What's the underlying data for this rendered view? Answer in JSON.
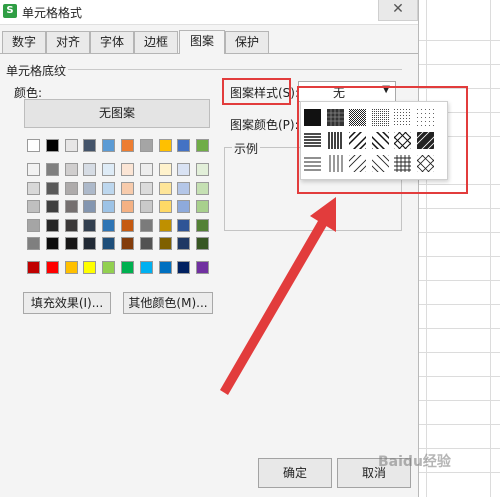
{
  "window": {
    "title": "单元格格式",
    "app_icon_glyph": "S",
    "close_glyph": "✕"
  },
  "tabs": [
    {
      "label": "数字"
    },
    {
      "label": "对齐"
    },
    {
      "label": "字体"
    },
    {
      "label": "边框"
    },
    {
      "label": "图案",
      "active": true
    },
    {
      "label": "保护"
    }
  ],
  "shading": {
    "section_title": "单元格底纹",
    "color_label": "颜色:",
    "no_pattern_button": "无图案",
    "fill_effects_button": "填充效果(I)...",
    "more_colors_button": "其他颜色(M)..."
  },
  "palette": {
    "top_row": [
      "#ffffff",
      "#000000",
      "#e7e6e6",
      "#44546a",
      "#5b9bd5",
      "#ed7d31",
      "#a5a5a5",
      "#ffc000",
      "#4472c4",
      "#70ad47"
    ],
    "rows": [
      [
        "#f2f2f2",
        "#7f7f7f",
        "#d0cece",
        "#d6dce4",
        "#deebf6",
        "#fbe5d5",
        "#ededed",
        "#fff2cc",
        "#d9e2f3",
        "#e2efd9"
      ],
      [
        "#d8d8d8",
        "#595959",
        "#aeabab",
        "#adb9ca",
        "#bdd7ee",
        "#f7cbac",
        "#dbdbdb",
        "#fee599",
        "#b4c6e7",
        "#c5e0b3"
      ],
      [
        "#bfbfbf",
        "#3f3f3f",
        "#757070",
        "#8496b0",
        "#9dc3e6",
        "#f4b183",
        "#c9c9c9",
        "#ffd966",
        "#8eaadb",
        "#a8d08d"
      ],
      [
        "#a5a5a5",
        "#262626",
        "#3a3838",
        "#323f4f",
        "#2e75b5",
        "#c55a11",
        "#7b7b7b",
        "#bf9000",
        "#2f5496",
        "#538135"
      ],
      [
        "#7f7f7f",
        "#0c0c0c",
        "#171616",
        "#222a35",
        "#1e4e79",
        "#833c0b",
        "#525252",
        "#7f6000",
        "#1f3864",
        "#375623"
      ]
    ],
    "standard": [
      "#c00000",
      "#ff0000",
      "#ffc000",
      "#ffff00",
      "#92d050",
      "#00b050",
      "#00b0f0",
      "#0070c0",
      "#002060",
      "#7030a0"
    ]
  },
  "pattern": {
    "style_label": "图案样式(S):",
    "style_value": "无",
    "color_label": "图案颜色(P):",
    "sample_label": "示例"
  },
  "pattern_popup": {
    "rows": [
      [
        "solid",
        "dark-grid-75",
        "gray-50",
        "gray-25",
        "gray-12",
        "gray-6"
      ],
      [
        "horizontal-stripe",
        "vertical-stripe",
        "reverse-diagonal-stripe",
        "diagonal-stripe",
        "diagonal-crosshatch",
        "thick-diagonal-crosshatch"
      ],
      [
        "thin-horizontal-stripe",
        "thin-vertical-stripe",
        "thin-reverse-diagonal-stripe",
        "thin-diagonal-stripe",
        "thin-horizontal-crosshatch",
        "thin-diagonal-crosshatch"
      ]
    ]
  },
  "footer": {
    "ok_button": "确定",
    "cancel_button": "取消"
  },
  "watermark": "Baidu经验",
  "annotation_color": "#e23c3c"
}
